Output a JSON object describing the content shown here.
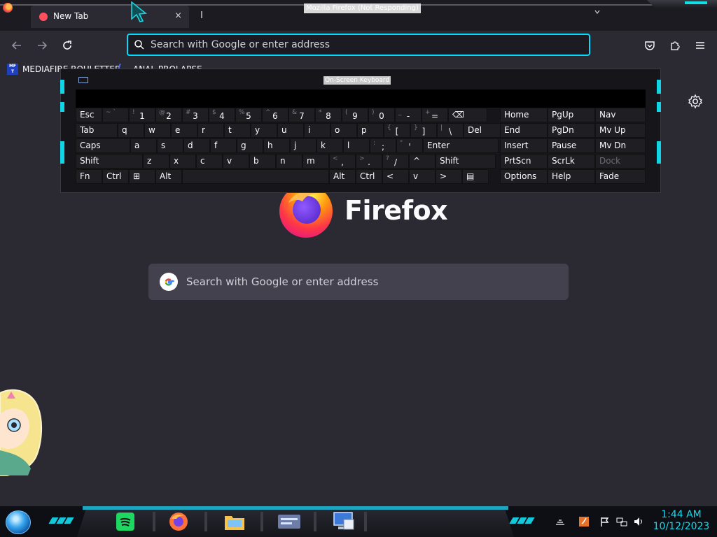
{
  "window": {
    "title": "Mozilla Firefox (Not Responding)"
  },
  "tabs": [
    {
      "label": "New Tab",
      "close": "×"
    }
  ],
  "toolbar": {
    "search_placeholder": "Search with Google or enter address"
  },
  "bookmarks": [
    {
      "icon": "mediafire-icon",
      "icon_text": "MF T",
      "label": "MEDIAFIRE ROULETTER"
    },
    {
      "icon": "bookmark-logo-icon",
      "label": "ANAL PROLAPSE"
    }
  ],
  "newtab": {
    "brand": "Firefox",
    "search_placeholder": "Search with Google or enter address"
  },
  "osk": {
    "title": "On-Screen Keyboard",
    "rows": {
      "r1": [
        {
          "l": "Esc"
        },
        {
          "s": "~ `",
          "l": ""
        },
        {
          "s": "!",
          "l": "1"
        },
        {
          "s": "@",
          "l": "2"
        },
        {
          "s": "#",
          "l": "3"
        },
        {
          "s": "$",
          "l": "4"
        },
        {
          "s": "%",
          "l": "5"
        },
        {
          "s": "^",
          "l": "6"
        },
        {
          "s": "&",
          "l": "7"
        },
        {
          "s": "*",
          "l": "8"
        },
        {
          "s": "(",
          "l": "9"
        },
        {
          "s": ")",
          "l": "0"
        },
        {
          "s": "_",
          "l": "-"
        },
        {
          "s": "+",
          "l": "="
        },
        {
          "l": "⌫"
        }
      ],
      "r2": [
        {
          "l": "Tab"
        },
        {
          "l": "q"
        },
        {
          "l": "w"
        },
        {
          "l": "e"
        },
        {
          "l": "r"
        },
        {
          "l": "t"
        },
        {
          "l": "y"
        },
        {
          "l": "u"
        },
        {
          "l": "i"
        },
        {
          "l": "o"
        },
        {
          "l": "p"
        },
        {
          "s": "{",
          "l": "["
        },
        {
          "s": "}",
          "l": "]"
        },
        {
          "s": "|",
          "l": "\\"
        },
        {
          "l": "Del"
        }
      ],
      "r3": [
        {
          "l": "Caps"
        },
        {
          "l": "a"
        },
        {
          "l": "s"
        },
        {
          "l": "d"
        },
        {
          "l": "f"
        },
        {
          "l": "g"
        },
        {
          "l": "h"
        },
        {
          "l": "j"
        },
        {
          "l": "k"
        },
        {
          "l": "l"
        },
        {
          "s": ":",
          "l": ";"
        },
        {
          "s": "\"",
          "l": "'"
        },
        {
          "l": "Enter"
        }
      ],
      "r4": [
        {
          "l": "Shift"
        },
        {
          "l": "z"
        },
        {
          "l": "x"
        },
        {
          "l": "c"
        },
        {
          "l": "v"
        },
        {
          "l": "b"
        },
        {
          "l": "n"
        },
        {
          "l": "m"
        },
        {
          "s": "<",
          "l": ","
        },
        {
          "s": ">",
          "l": "."
        },
        {
          "s": "?",
          "l": "/"
        },
        {
          "l": "^"
        },
        {
          "l": "Shift"
        }
      ],
      "r5": [
        {
          "l": "Fn"
        },
        {
          "l": "Ctrl"
        },
        {
          "l": "⊞"
        },
        {
          "l": "Alt"
        },
        {
          "l": ""
        },
        {
          "l": "Alt"
        },
        {
          "l": "Ctrl"
        },
        {
          "l": "<"
        },
        {
          "l": "v"
        },
        {
          "l": ">"
        },
        {
          "l": "▤"
        }
      ]
    },
    "nav_keys": [
      [
        "Home",
        "PgUp",
        "Nav"
      ],
      [
        "End",
        "PgDn",
        "Mv Up"
      ],
      [
        "Insert",
        "Pause",
        "Mv Dn"
      ],
      [
        "PrtScn",
        "ScrLk",
        "Dock"
      ],
      [
        "Options",
        "Help",
        "Fade"
      ]
    ]
  },
  "taskbar": {
    "apps": [
      "spotify-icon",
      "firefox-icon",
      "file-explorer-icon",
      "control-panel-icon",
      "remote-desktop-icon"
    ],
    "clock": {
      "time": "1:44 AM",
      "date": "10/12/2023"
    }
  },
  "colors": {
    "accent": "#00ddff",
    "frame_glow": "#11d4e6",
    "page_bg": "#2b2a33"
  }
}
